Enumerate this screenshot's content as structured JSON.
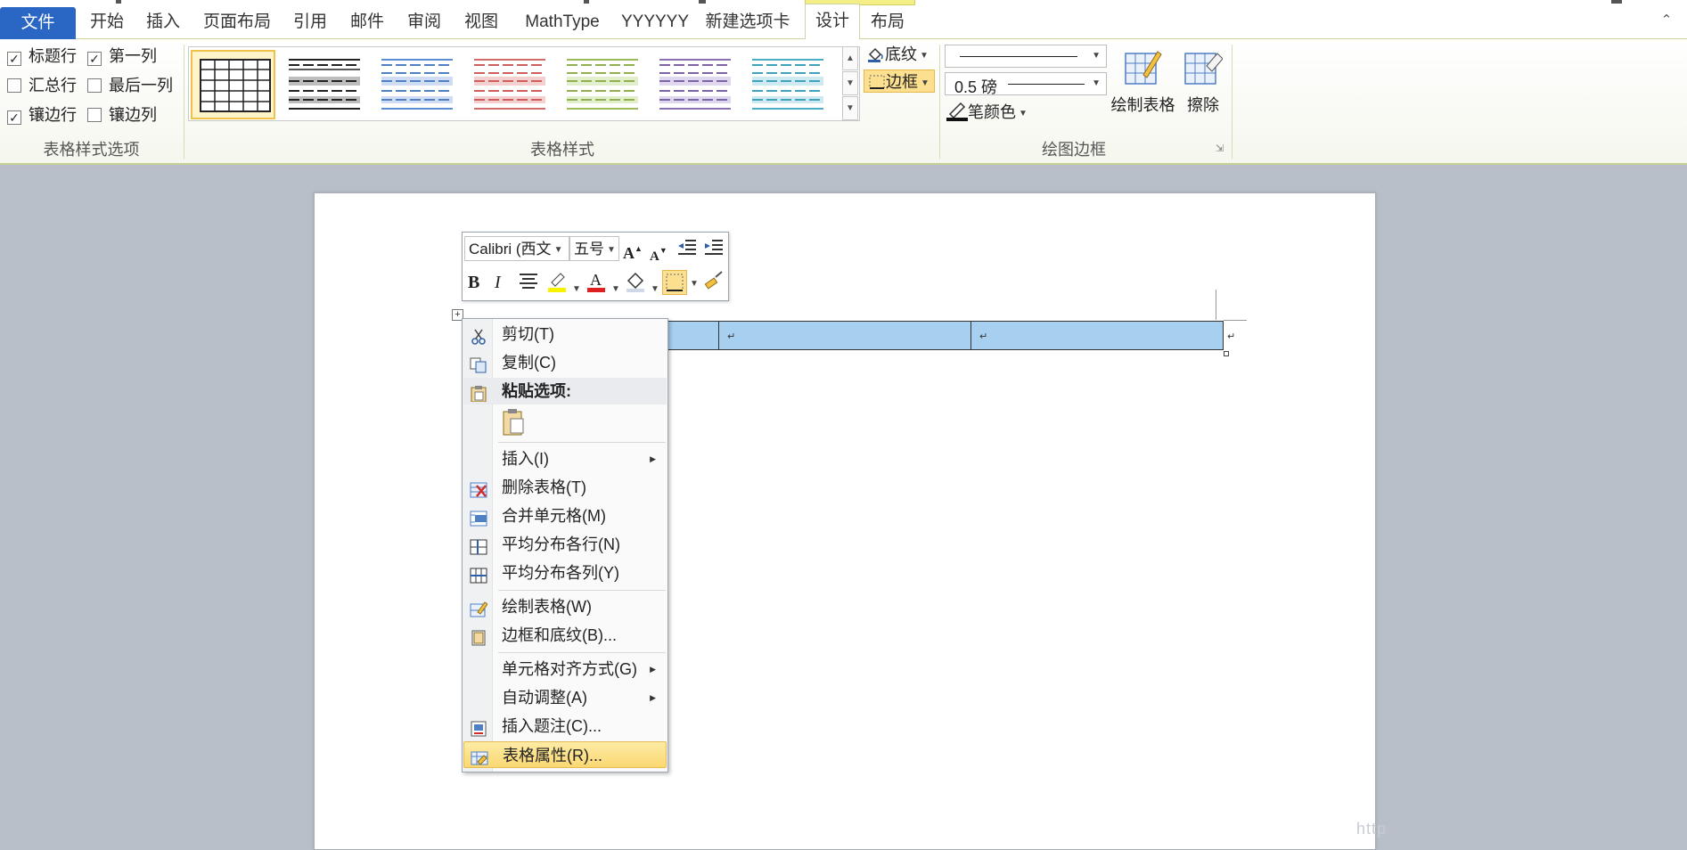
{
  "tabs": {
    "file": "文件",
    "items": [
      "开始",
      "插入",
      "页面布局",
      "引用",
      "邮件",
      "审阅",
      "视图",
      "MathType",
      "YYYYYY",
      "新建选项卡",
      "设计",
      "布局"
    ],
    "active": "设计"
  },
  "ribbon": {
    "style_options": {
      "group_label": "表格样式选项",
      "header_row": "标题行",
      "first_column": "第一列",
      "total_row": "汇总行",
      "last_column": "最后一列",
      "banded_rows": "镶边行",
      "banded_columns": "镶边列"
    },
    "table_styles": {
      "group_label": "表格样式",
      "shading": "底纹",
      "borders": "边框"
    },
    "draw_borders": {
      "group_label": "绘图边框",
      "line_weight": "0.5 磅",
      "pen_color": "笔颜色",
      "draw_table": "绘制表格",
      "eraser": "擦除"
    }
  },
  "minibar": {
    "font": "Calibri (西文",
    "size": "五号"
  },
  "context_menu": {
    "cut": "剪切(T)",
    "copy": "复制(C)",
    "paste_options": "粘贴选项:",
    "insert": "插入(I)",
    "delete_table": "删除表格(T)",
    "merge_cells": "合并单元格(M)",
    "distribute_rows": "平均分布各行(N)",
    "distribute_columns": "平均分布各列(Y)",
    "draw_table": "绘制表格(W)",
    "borders_shading": "边框和底纹(B)...",
    "cell_alignment": "单元格对齐方式(G)",
    "autofit": "自动调整(A)",
    "insert_caption": "插入题注(C)...",
    "table_properties": "表格属性(R)..."
  },
  "watermark": "http"
}
